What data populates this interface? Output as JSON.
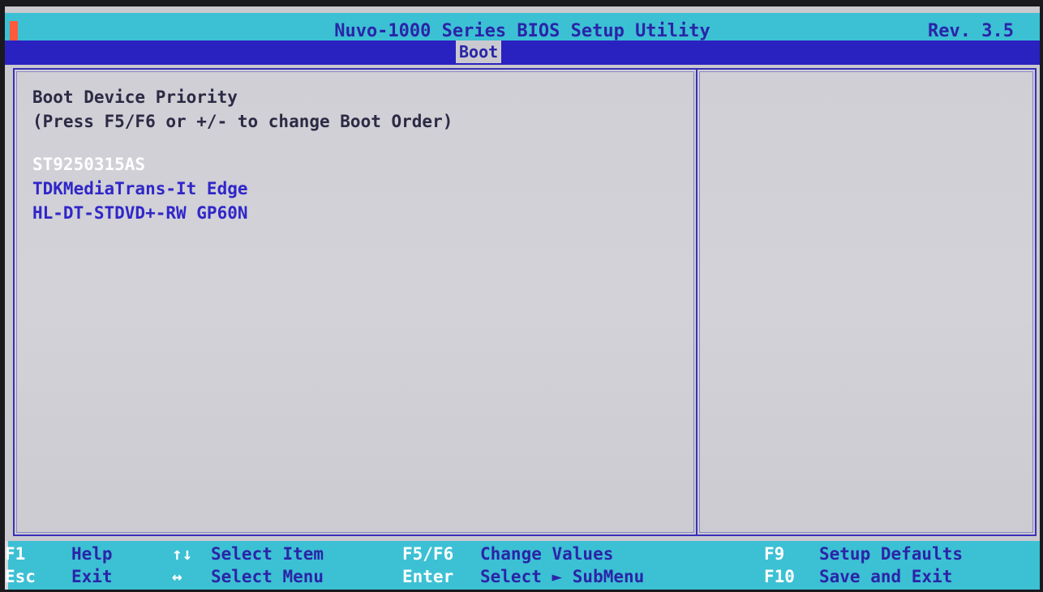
{
  "header": {
    "title": "Nuvo-1000 Series BIOS Setup Utility",
    "revision": "Rev. 3.5"
  },
  "menu": {
    "active_tab": "Boot"
  },
  "main": {
    "section_title": "Boot Device Priority",
    "section_hint": "(Press F5/F6 or +/- to change Boot Order)",
    "boot_devices": [
      {
        "label": "ST9250315AS",
        "selected": true
      },
      {
        "label": "TDKMediaTrans-It Edge",
        "selected": false
      },
      {
        "label": "HL-DT-STDVD+-RW GP60N",
        "selected": false
      }
    ]
  },
  "footer": {
    "row1": [
      {
        "key": "F1",
        "label": "Help"
      },
      {
        "key": "↑↓",
        "label": "Select Item"
      },
      {
        "key": "F5/F6",
        "label": "Change Values"
      },
      {
        "key": "F9",
        "label": "Setup Defaults"
      }
    ],
    "row2": [
      {
        "key": "Esc",
        "label": "Exit"
      },
      {
        "key": "↔",
        "label": "Select Menu"
      },
      {
        "key": "Enter",
        "label": "Select ► SubMenu"
      },
      {
        "key": "F10",
        "label": "Save and Exit"
      }
    ]
  },
  "colors": {
    "title_bar": "#3cc0d4",
    "menu_bar": "#2a22c0",
    "panel_background": "#c9c9cf",
    "highlight_text": "#ffffff",
    "item_text": "#3026c8"
  }
}
